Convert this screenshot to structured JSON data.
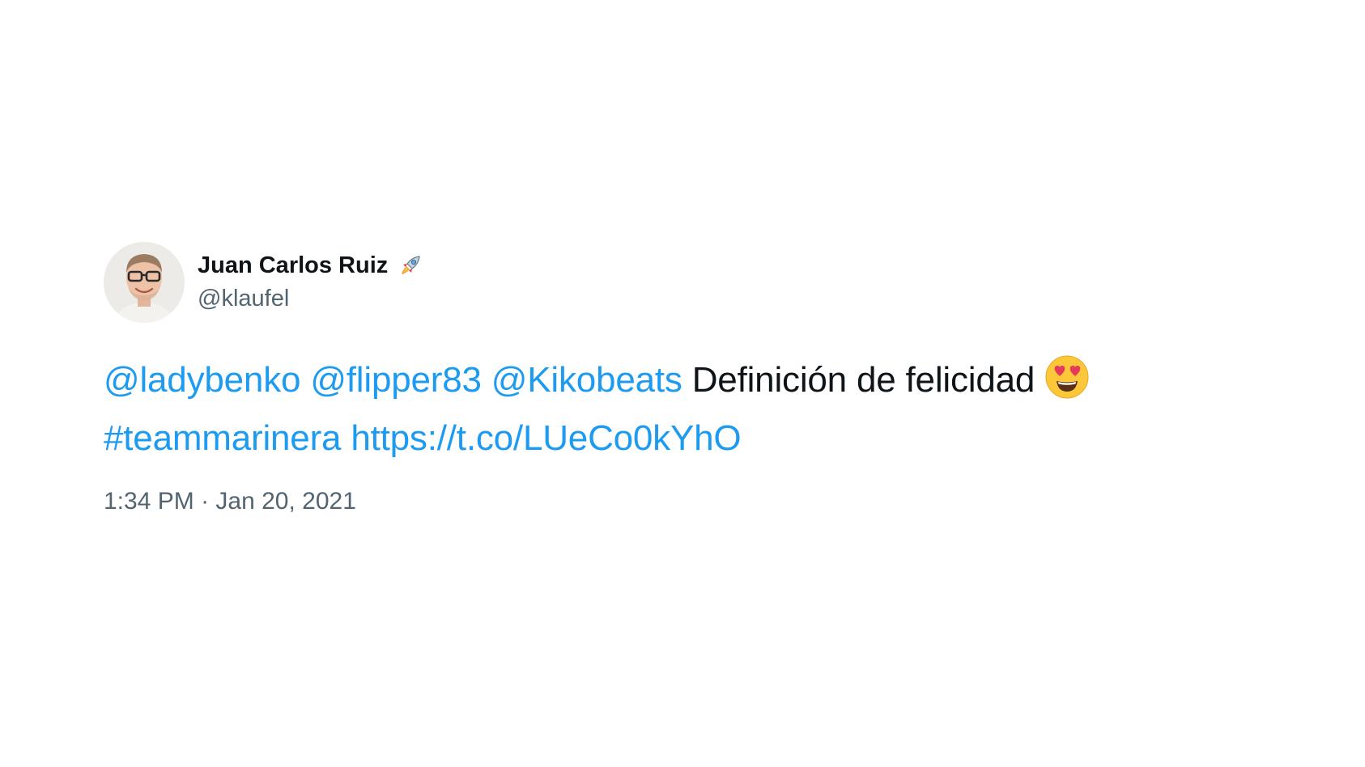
{
  "author": {
    "display_name": "Juan Carlos Ruiz",
    "display_name_emoji": "rocket-icon",
    "handle": "@klaufel",
    "avatar_icon": "avatar-photo"
  },
  "tweet": {
    "mention_1": "@ladybenko",
    "mention_2": "@flipper83",
    "mention_3": "@Kikobeats",
    "text": "Definición de felicidad",
    "emoji": "smiling-face-with-heart-eyes-icon",
    "hashtag": "#teammarinera",
    "url": "https://t.co/LUeCo0kYhO"
  },
  "meta": {
    "time": "1:34 PM",
    "separator": "·",
    "date": "Jan 20, 2021"
  },
  "colors": {
    "link": "#1d9bf0",
    "text": "#0f1419",
    "secondary": "#536471",
    "background": "#ffffff"
  }
}
